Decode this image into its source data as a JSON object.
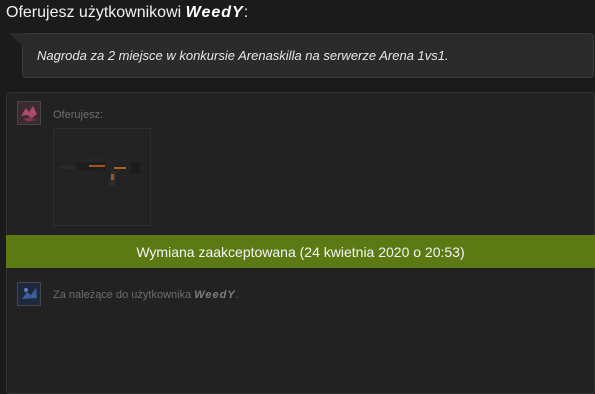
{
  "header": {
    "prefix": "Oferujesz użytkownikowi",
    "username": "WeedY",
    "suffix": ":"
  },
  "message": {
    "text": "Nagroda za 2 miejsce w konkursie Arenaskilla na serwerze Arena 1vs1."
  },
  "offer": {
    "label": "Oferujesz:",
    "item_icon": "rifle-item-icon"
  },
  "status": {
    "text": "Wymiana zaakceptowana (24 kwietnia 2020 o 20:53)",
    "color": "#5b7a14"
  },
  "receive": {
    "label_prefix": "Za należące do użytkownika",
    "username": "WeedY",
    "suffix": "."
  }
}
